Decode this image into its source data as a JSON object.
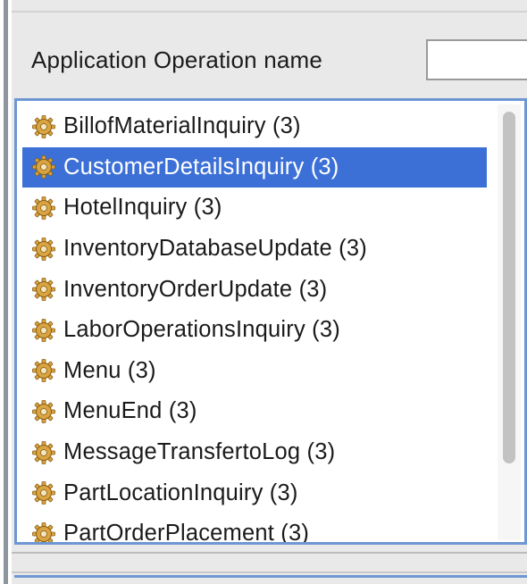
{
  "filter": {
    "label": "Application Operation name",
    "value": "",
    "placeholder": ""
  },
  "list": {
    "selected_index": 1,
    "icon": "gear-icon",
    "items": [
      {
        "label": "BillofMaterialInquiry (3)"
      },
      {
        "label": "CustomerDetailsInquiry (3)"
      },
      {
        "label": "HotelInquiry (3)"
      },
      {
        "label": "InventoryDatabaseUpdate (3)"
      },
      {
        "label": "InventoryOrderUpdate (3)"
      },
      {
        "label": "LaborOperationsInquiry (3)"
      },
      {
        "label": "Menu (3)"
      },
      {
        "label": "MenuEnd (3)"
      },
      {
        "label": "MessageTransfertoLog (3)"
      },
      {
        "label": "PartLocationInquiry (3)"
      },
      {
        "label": "PartOrderPlacement (3)"
      }
    ]
  },
  "colors": {
    "selection": "#3c70d7",
    "focus_border": "#6d97d3",
    "gear": "#d9a441"
  }
}
